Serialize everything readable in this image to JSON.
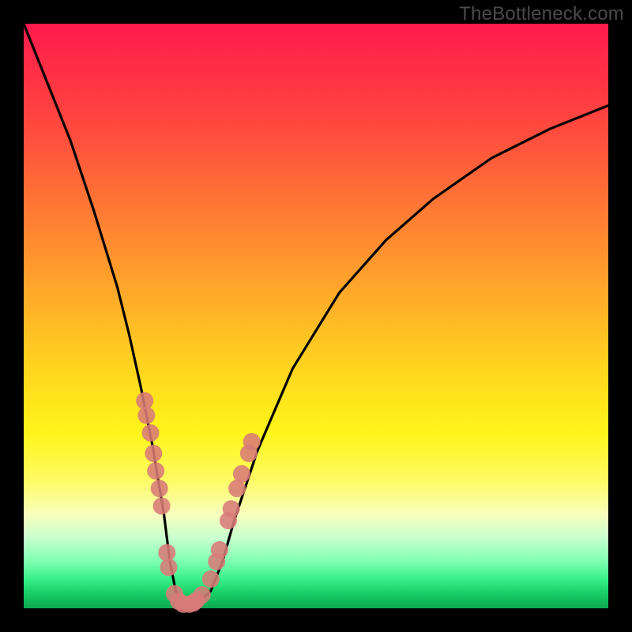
{
  "watermark": "TheBottleneck.com",
  "chart_data": {
    "type": "line",
    "title": "",
    "xlabel": "",
    "ylabel": "",
    "xlim": [
      0,
      100
    ],
    "ylim": [
      0,
      100
    ],
    "grid": false,
    "legend": false,
    "series": [
      {
        "name": "bottleneck-curve",
        "x": [
          0,
          4,
          8,
          12,
          16,
          18,
          20,
          22,
          24,
          25,
          26,
          27,
          28,
          29,
          30,
          32,
          34,
          36,
          40,
          46,
          54,
          62,
          70,
          80,
          90,
          100
        ],
        "y": [
          100,
          90,
          80,
          68,
          55,
          47,
          38,
          28,
          16,
          8,
          3,
          1,
          0,
          0,
          1,
          3,
          8,
          15,
          27,
          41,
          54,
          63,
          70,
          77,
          82,
          86
        ]
      }
    ],
    "annotations": {
      "scatter_points": [
        {
          "x": 20.7,
          "y": 35.5
        },
        {
          "x": 21.0,
          "y": 33.0
        },
        {
          "x": 21.7,
          "y": 30.0
        },
        {
          "x": 22.2,
          "y": 26.5
        },
        {
          "x": 22.6,
          "y": 23.5
        },
        {
          "x": 23.2,
          "y": 20.5
        },
        {
          "x": 23.6,
          "y": 17.5
        },
        {
          "x": 24.5,
          "y": 9.5
        },
        {
          "x": 24.8,
          "y": 7.0
        },
        {
          "x": 25.8,
          "y": 2.5
        },
        {
          "x": 26.5,
          "y": 1.2
        },
        {
          "x": 27.3,
          "y": 0.7
        },
        {
          "x": 28.3,
          "y": 0.7
        },
        {
          "x": 29.0,
          "y": 0.9
        },
        {
          "x": 29.5,
          "y": 1.3
        },
        {
          "x": 30.5,
          "y": 2.3
        },
        {
          "x": 32.0,
          "y": 5.0
        },
        {
          "x": 33.0,
          "y": 8.0
        },
        {
          "x": 33.5,
          "y": 10.0
        },
        {
          "x": 35.0,
          "y": 15.0
        },
        {
          "x": 35.5,
          "y": 17.0
        },
        {
          "x": 36.5,
          "y": 20.5
        },
        {
          "x": 37.3,
          "y": 23.0
        },
        {
          "x": 38.5,
          "y": 26.5
        },
        {
          "x": 39.0,
          "y": 28.5
        }
      ]
    }
  }
}
